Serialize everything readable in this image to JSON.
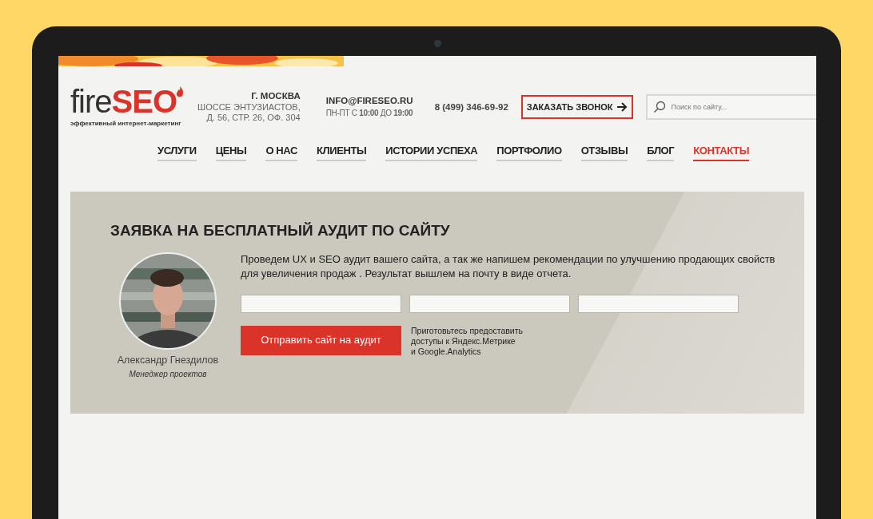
{
  "logo": {
    "prefix": "fire",
    "highlight": "SEO",
    "tagline": "эффективный интернет-маркетинг"
  },
  "address": {
    "city": "Г. МОСКВА",
    "lines": [
      "ШОССЕ ЭНТУЗИАСТОВ,",
      "Д. 56, СТР. 26, ОФ. 304"
    ]
  },
  "contact": {
    "email": "INFO@FIRESEO.RU",
    "hours": "ПН-ПТ С **10:00** ДО **19:00**"
  },
  "phone": "8 (499) **346-69-92**",
  "callback_button": "ЗАКАЗАТЬ ЗВОНОК",
  "search": {
    "placeholder": "Поиск по сайту..."
  },
  "nav": [
    {
      "label": "УСЛУГИ",
      "selected": false
    },
    {
      "label": "ЦЕНЫ",
      "selected": false
    },
    {
      "label": "О НАС",
      "selected": false
    },
    {
      "label": "КЛИЕНТЫ",
      "selected": false
    },
    {
      "label": "ИСТОРИИ УСПЕХА",
      "selected": false
    },
    {
      "label": "ПОРТФОЛИО",
      "selected": false
    },
    {
      "label": "ОТЗЫВЫ",
      "selected": false
    },
    {
      "label": "БЛОГ",
      "selected": false
    },
    {
      "label": "КОНТАКТЫ",
      "selected": true
    }
  ],
  "audit": {
    "title": "ЗАЯВКА НА БЕСПЛАТНЫЙ АУДИТ ПО САЙТУ",
    "description": "Проведем UX и SEO аудит вашего сайта, а так же напишем рекомендации по улучшению продающих свойств для увеличения продаж . Результат вышлем на почту в виде отчета.",
    "fields": [
      {
        "kind": "text"
      },
      {
        "kind": "text"
      },
      {
        "kind": "text"
      }
    ],
    "submit_button": "Отправить сайт на аудит",
    "note": "Приготовьтесь предоставить\nдоступы к Яндекс.Метрике\nи Google.Analytics",
    "manager": {
      "name": "Александр Гнездилов",
      "role": "Менеджер проектов"
    }
  }
}
